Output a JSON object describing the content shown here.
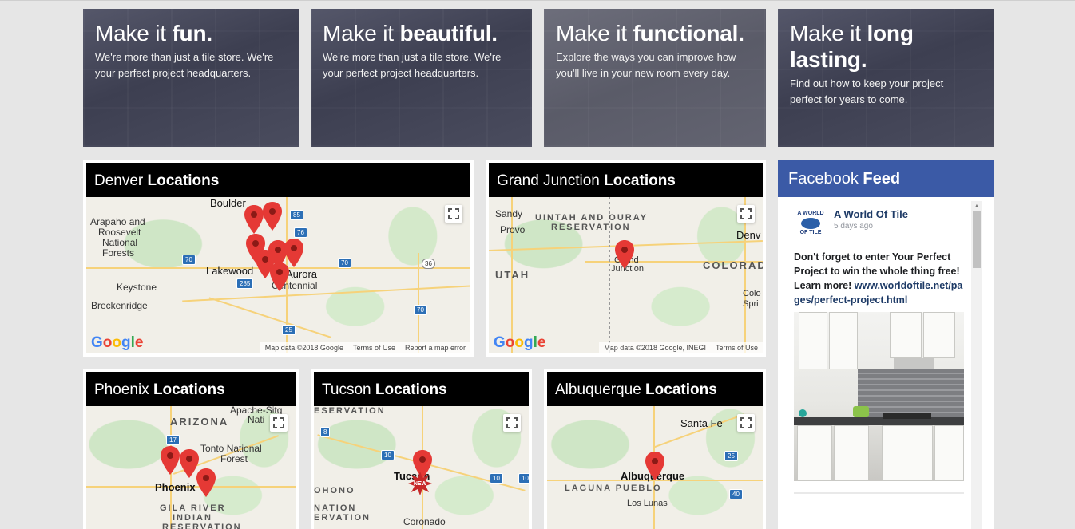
{
  "tiles": [
    {
      "lead": "Make it ",
      "bold": "fun.",
      "text": "We're more than just a tile store. We're your perfect project headquarters."
    },
    {
      "lead": "Make it ",
      "bold": "beautiful.",
      "text": "We're more than just a tile store. We're your perfect project headquarters."
    },
    {
      "lead": "Make it ",
      "bold": "functional.",
      "text": "Explore the ways you can improve how you'll live in your new room every day."
    },
    {
      "lead": "Make it ",
      "bold": "long lasting.",
      "text": "Find out how to keep your project perfect for years to come."
    }
  ],
  "maps": {
    "denver": {
      "city": "Denver ",
      "suffix": "Locations",
      "labels": [
        "Boulder",
        "Arapaho and",
        "Roosevelt",
        "National",
        "Forests",
        "Lakewood",
        "Keystone",
        "Breckenridge",
        "Aurora",
        "Centennial"
      ],
      "attribution": [
        "Map data ©2018 Google",
        "Terms of Use",
        "Report a map error"
      ]
    },
    "grand_junction": {
      "city": "Grand Junction ",
      "suffix": "Locations",
      "labels": [
        "Sandy",
        "Provo",
        "UINTAH AND OURAY",
        "RESERVATION",
        "UTAH",
        "Grand",
        "Junction",
        "Denv",
        "COLORAD",
        "Colo",
        "Spri"
      ],
      "attribution": [
        "Map data ©2018 Google, INEGI",
        "Terms of Use"
      ]
    },
    "phoenix": {
      "city": "Phoenix ",
      "suffix": "Locations",
      "labels": [
        "Apache-Sitg",
        "Nati",
        "ARIZONA",
        "Tonto National",
        "Forest",
        "Phoenix",
        "GILA RIVER",
        "INDIAN",
        "RESERVATION"
      ]
    },
    "tucson": {
      "city": "Tucson ",
      "suffix": "Locations",
      "labels": [
        "ESERVATION",
        "Tucson",
        "OHONO",
        "NATION",
        "ERVATION",
        "Coronado"
      ],
      "badge": "NEW"
    },
    "albuquerque": {
      "city": "Albuquerque ",
      "suffix": "Locations",
      "labels": [
        "Santa Fe",
        "Albuquerque",
        "LAGUNA PUEBLO",
        "Los Lunas"
      ]
    },
    "google_logo": [
      "G",
      "o",
      "o",
      "g",
      "l",
      "e"
    ]
  },
  "facebook": {
    "title_lead": "Facebook ",
    "title_bold": "Feed",
    "logo_top": "A WORLD",
    "logo_bottom": "OF TILE",
    "page_name": "A World Of Tile",
    "time": "5 days ago",
    "post_text": "Don't forget to enter Your Perfect Project to win the whole thing free! Learn more!",
    "post_link": "www.worldoftile.net/pages/perfect-project.html"
  },
  "colors": {
    "facebook_blue": "#3b5aa6",
    "pin_red": "#e53935",
    "header_black": "#000000"
  }
}
